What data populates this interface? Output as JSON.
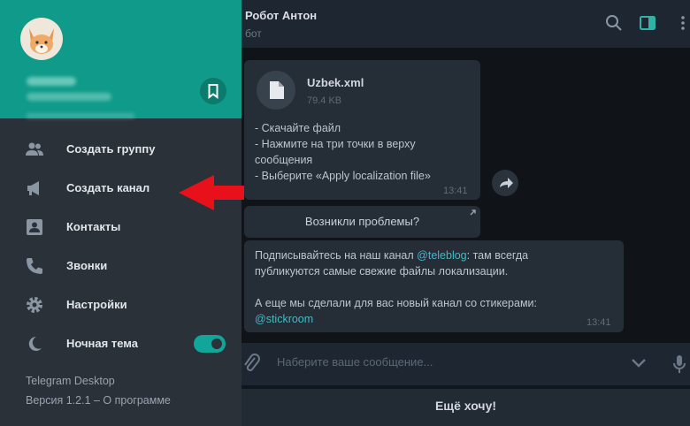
{
  "chat": {
    "title": "Робот Антон",
    "subtitle": "бот",
    "file": {
      "name": "Uzbek.xml",
      "size": "79.4 KB"
    },
    "message1": {
      "text": "- Скачайте файл\n- Нажмите на три точки в верху\nсообщения\n- Выберите «Apply localization file»",
      "time": "13:41"
    },
    "keyboard_button": "Возникли проблемы?",
    "message2": {
      "line1_prefix": "Подписывайтесь на наш канал ",
      "link1": "@teleblog",
      "line1_suffix": ": там всегда\nпубликуются самые свежие файлы локализации.",
      "line2": "А еще мы сделали для вас новый канал со стикерами:",
      "link2": "@stickroom",
      "time": "13:41"
    },
    "composer_placeholder": "Наберите ваше сообщение...",
    "bottom_button": "Ещё хочу!"
  },
  "menu": {
    "items": [
      {
        "label": "Создать группу",
        "icon": "group-icon"
      },
      {
        "label": "Создать канал",
        "icon": "channel-megaphone-icon"
      },
      {
        "label": "Контакты",
        "icon": "contacts-icon"
      },
      {
        "label": "Звонки",
        "icon": "phone-icon"
      },
      {
        "label": "Настройки",
        "icon": "gear-icon"
      },
      {
        "label": "Ночная тема",
        "icon": "moon-icon",
        "toggle": true
      }
    ],
    "footer_app": "Telegram Desktop",
    "footer_version": "Версия 1.2.1 – О программе"
  },
  "colors": {
    "accent": "#0f9a89",
    "menu_bg": "#2b3139",
    "arrow": "#e8101a",
    "link": "#4ab5c9"
  }
}
